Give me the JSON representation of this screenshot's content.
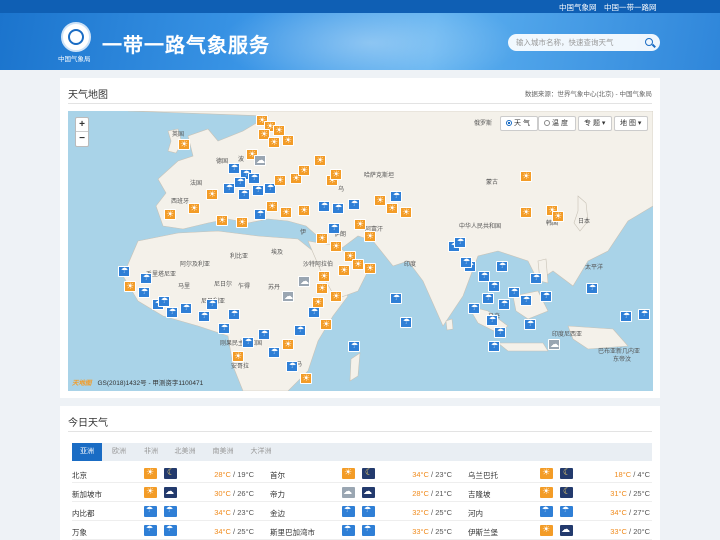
{
  "topbar": {
    "link1": "中国气象网",
    "link2": "中国一带一路网"
  },
  "header": {
    "logo_text": "中国气象局",
    "title": "一带一路气象服务",
    "search_placeholder": "输入城市名称，快速查询天气"
  },
  "map_panel": {
    "title": "天气地图",
    "source": "数据来源：世界气象中心(北京) - 中国气象局",
    "zoom_in": "+",
    "zoom_out": "−",
    "layer_weather": "天 气",
    "layer_temp": "温 度",
    "topic_label": "专 题",
    "map_label": "地 图",
    "brand": "天地图",
    "copyright": "GS(2018)1432号 - 甲测资字1100471",
    "labels": [
      {
        "text": "俄罗斯",
        "id": "russia"
      },
      {
        "text": "英国",
        "id": "uk"
      },
      {
        "text": "德国",
        "id": "germany"
      },
      {
        "text": "波",
        "id": "poland"
      },
      {
        "text": "法国",
        "id": "france"
      },
      {
        "text": "西班牙",
        "id": "spain"
      },
      {
        "text": "哈萨克斯坦",
        "id": "kazakhstan"
      },
      {
        "text": "蒙古",
        "id": "mongolia"
      },
      {
        "text": "中华人民共和国",
        "id": "china"
      },
      {
        "text": "日本",
        "id": "japan"
      },
      {
        "text": "韩国",
        "id": "korea"
      },
      {
        "text": "印度",
        "id": "india"
      },
      {
        "text": "伊朗",
        "id": "iran"
      },
      {
        "text": "阿富汗",
        "id": "afghanistan"
      },
      {
        "text": "沙特阿拉伯",
        "id": "saudi"
      },
      {
        "text": "埃及",
        "id": "egypt"
      },
      {
        "text": "利比亚",
        "id": "libya"
      },
      {
        "text": "阿尔及利亚",
        "id": "algeria"
      },
      {
        "text": "毛里塔尼亚",
        "id": "mauritania"
      },
      {
        "text": "马里",
        "id": "mali"
      },
      {
        "text": "尼日尔",
        "id": "niger"
      },
      {
        "text": "乍得",
        "id": "chad"
      },
      {
        "text": "苏丹",
        "id": "sudan"
      },
      {
        "text": "尼日利亚",
        "id": "nigeria"
      },
      {
        "text": "刚果民主共和国",
        "id": "drc"
      },
      {
        "text": "安哥拉",
        "id": "angola"
      },
      {
        "text": "马",
        "id": "ma"
      },
      {
        "text": "印度尼西亚",
        "id": "indonesia"
      },
      {
        "text": "巴布亚新几内亚",
        "id": "png"
      },
      {
        "text": "太平洋",
        "id": "pacific"
      },
      {
        "text": "东帝汶",
        "id": "timor"
      },
      {
        "text": "马来",
        "id": "malay"
      },
      {
        "text": "乌",
        "id": "uz"
      },
      {
        "text": "伊",
        "id": "iraq"
      }
    ]
  },
  "today_panel": {
    "title": "今日天气",
    "tabs": [
      "亚洲",
      "欧洲",
      "非洲",
      "北美洲",
      "南美洲",
      "大洋洲"
    ],
    "rows": [
      [
        {
          "city": "北京",
          "day": "sunny",
          "night": "night",
          "hi": "28°C",
          "lo": "19°C"
        },
        {
          "city": "首尔",
          "day": "sunny",
          "night": "night",
          "hi": "34°C",
          "lo": "23°C"
        },
        {
          "city": "乌兰巴托",
          "day": "sunny",
          "night": "night",
          "hi": "18°C",
          "lo": "4°C"
        }
      ],
      [
        {
          "city": "新加坡市",
          "day": "sunny",
          "night": "nightcloud",
          "hi": "30°C",
          "lo": "26°C"
        },
        {
          "city": "帝力",
          "day": "cloudy",
          "night": "nightcloud",
          "hi": "28°C",
          "lo": "21°C"
        },
        {
          "city": "吉隆坡",
          "day": "sunny",
          "night": "night",
          "hi": "31°C",
          "lo": "25°C"
        }
      ],
      [
        {
          "city": "内比都",
          "day": "rain",
          "night": "nightrain",
          "hi": "34°C",
          "lo": "23°C"
        },
        {
          "city": "金边",
          "day": "rain",
          "night": "nightrain",
          "hi": "32°C",
          "lo": "25°C"
        },
        {
          "city": "河内",
          "day": "rain",
          "night": "nightrain",
          "hi": "34°C",
          "lo": "27°C"
        }
      ],
      [
        {
          "city": "万象",
          "day": "rain",
          "night": "nightrain",
          "hi": "34°C",
          "lo": "25°C"
        },
        {
          "city": "斯里巴加湾市",
          "day": "rain",
          "night": "nightrain",
          "hi": "33°C",
          "lo": "25°C"
        },
        {
          "city": "伊斯兰堡",
          "day": "sunny",
          "night": "nightcloud",
          "hi": "33°C",
          "lo": "20°C"
        }
      ]
    ]
  }
}
